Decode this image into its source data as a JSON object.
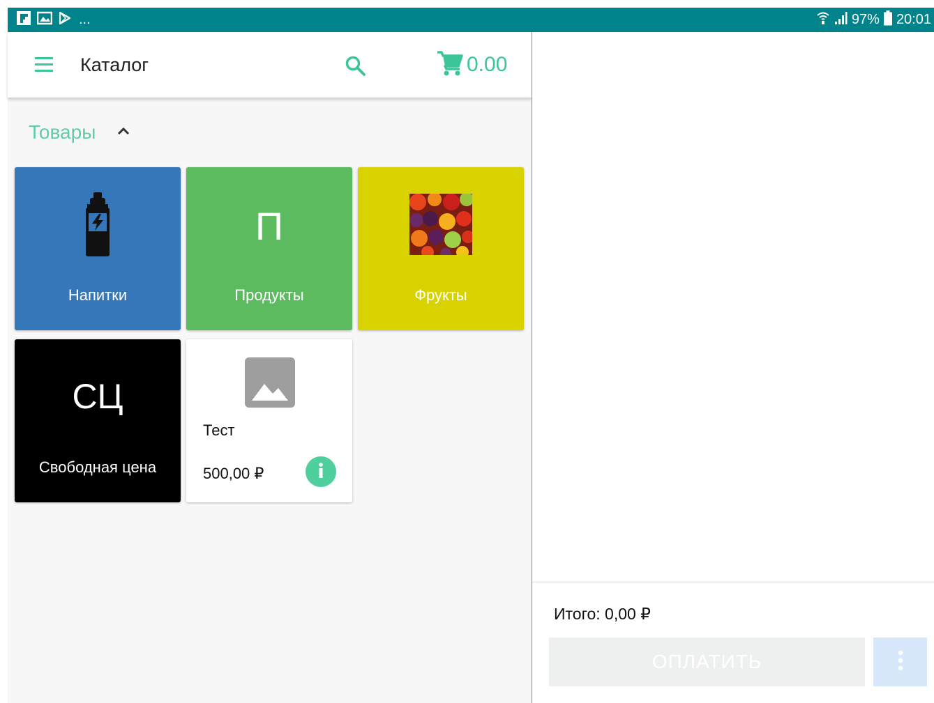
{
  "status_bar": {
    "left_icons": [
      "flipboard-icon",
      "gallery-icon",
      "play-store-icon"
    ],
    "overflow": "...",
    "battery": "97%",
    "time": "20:01"
  },
  "header": {
    "title": "Каталог",
    "cart_total": "0.00"
  },
  "catalog": {
    "section_title": "Товары",
    "tiles": [
      {
        "label": "Напитки",
        "color": "#3677b9",
        "icon": "bottle-icon"
      },
      {
        "label": "Продукты",
        "letter": "П",
        "color": "#5cba5f"
      },
      {
        "label": "Фрукты",
        "color": "#d8d200",
        "icon": "fruits-image"
      },
      {
        "label": "Свободная цена",
        "letter": "СЦ",
        "color": "#000000"
      }
    ],
    "product": {
      "name": "Тест",
      "price": "500,00 ₽",
      "image": "image-placeholder-icon",
      "info_color": "#4fcf9e"
    }
  },
  "receipt": {
    "total_label": "Итого: 0,00 ₽",
    "pay_label": "ОПЛАТИТЬ"
  },
  "colors": {
    "status_bar": "#00838a",
    "accent": "#3cc59a"
  }
}
